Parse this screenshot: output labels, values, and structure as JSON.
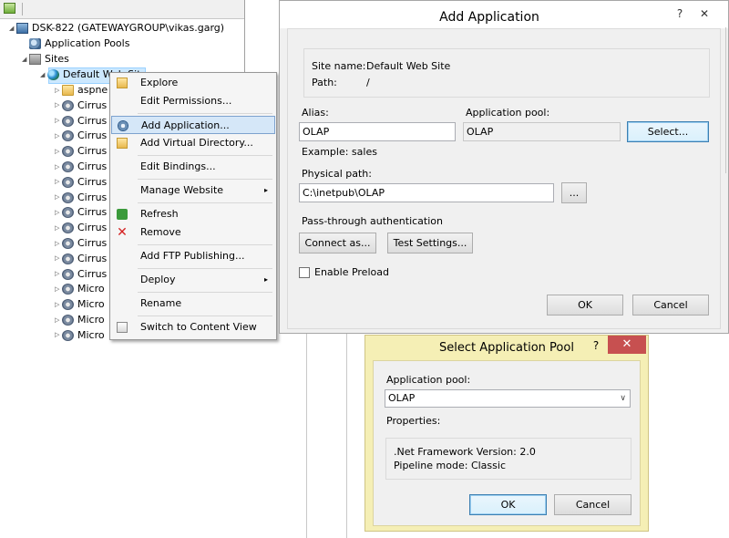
{
  "tree": {
    "server": "DSK-822 (GATEWAYGROUP\\vikas.garg)",
    "app_pools": "Application Pools",
    "sites": "Sites",
    "default_site": "Default Web Site",
    "children": [
      "aspne",
      "Cirrus",
      "Cirrus",
      "Cirrus",
      "Cirrus",
      "Cirrus",
      "Cirrus",
      "Cirrus",
      "Cirrus",
      "Cirrus",
      "Cirrus",
      "Cirrus",
      "Cirrus",
      "Micro",
      "Micro",
      "Micro",
      "Micro"
    ]
  },
  "context_menu": {
    "items": [
      {
        "label": "Explore",
        "icon": "explore-icon"
      },
      {
        "label": "Edit Permissions...",
        "icon": ""
      },
      {
        "label": "Add Application...",
        "icon": "add-application-icon",
        "highlighted": true
      },
      {
        "label": "Add Virtual Directory...",
        "icon": "virtual-directory-icon"
      },
      {
        "label": "Edit Bindings...",
        "icon": ""
      },
      {
        "label": "Manage Website",
        "icon": "",
        "submenu": true
      },
      {
        "label": "Refresh",
        "icon": "refresh-icon"
      },
      {
        "label": "Remove",
        "icon": "remove-icon"
      },
      {
        "label": "Add FTP Publishing...",
        "icon": ""
      },
      {
        "label": "Deploy",
        "icon": "",
        "submenu": true
      },
      {
        "label": "Rename",
        "icon": ""
      },
      {
        "label": "Switch to Content View",
        "icon": "content-view-icon"
      }
    ],
    "submenu_arrow": "▸"
  },
  "add_app": {
    "title": "Add Application",
    "help_glyph": "?",
    "close_glyph": "✕",
    "site_name_label": "Site name:",
    "site_name_value": "Default Web Site",
    "path_label": "Path:",
    "path_value": "/",
    "alias_label": "Alias:",
    "alias_value": "OLAP",
    "example": "Example: sales",
    "app_pool_label": "Application pool:",
    "app_pool_value": "OLAP",
    "select_button": "Select...",
    "physical_path_label": "Physical path:",
    "physical_path_value": "C:\\inetpub\\OLAP",
    "browse_button": "...",
    "pass_through_label": "Pass-through authentication",
    "connect_as_button": "Connect as...",
    "test_settings_button": "Test Settings...",
    "enable_preload_label": "Enable Preload",
    "ok_button": "OK",
    "cancel_button": "Cancel"
  },
  "select_pool": {
    "title": "Select Application Pool",
    "help_glyph": "?",
    "close_glyph": "✕",
    "app_pool_label": "Application pool:",
    "app_pool_value": "OLAP",
    "dropdown_glyph": "∨",
    "properties_label": "Properties:",
    "net_version": ".Net Framework Version: 2.0",
    "pipeline_mode": "Pipeline mode: Classic",
    "ok_button": "OK",
    "cancel_button": "Cancel"
  },
  "colors": {
    "highlight": "#cce8ff",
    "menu_highlight": "#d5e7f8",
    "close_red": "#c75050",
    "select_dialog_frame": "#f5efb5"
  }
}
